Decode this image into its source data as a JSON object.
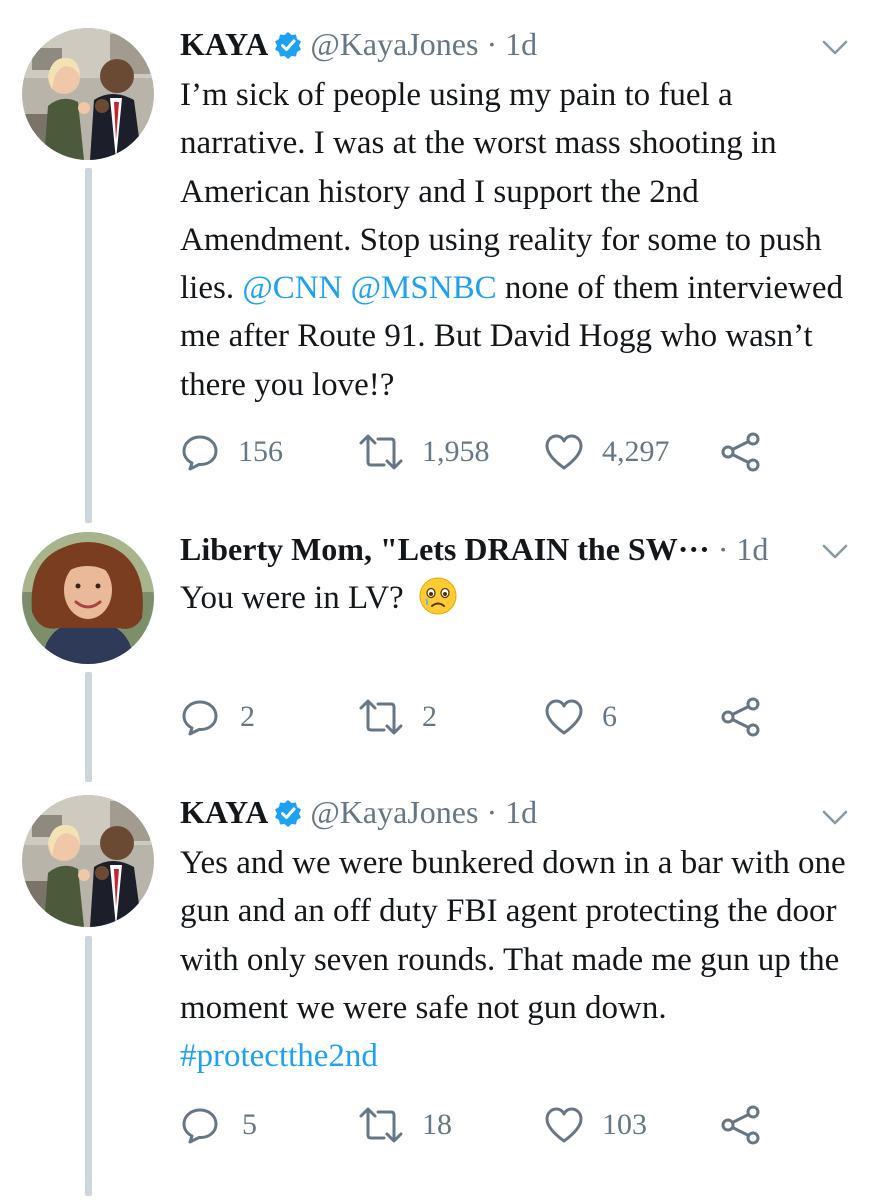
{
  "thread": [
    {
      "author": {
        "name": "KAYA",
        "verified": true,
        "handle": "@KayaJones",
        "separator": "·",
        "time": "1d",
        "avatar": "avatar-two-people-photo"
      },
      "text_parts": [
        "I’m sick of people using my pain to fuel a narrative. I was at the worst mass shooting in American history and I support the 2nd Amendment. Stop using reality for some to push lies. ",
        "@CNN",
        " ",
        "@MSNBC",
        " none of them interviewed me after Route 91. But David Hogg who wasn’t there you love!?"
      ],
      "actions": {
        "replies": "156",
        "retweets": "1,958",
        "likes": "4,297"
      }
    },
    {
      "author": {
        "name": "Liberty Mom, \"Lets DRAIN the SW···",
        "verified": false,
        "handle": "",
        "separator": "·",
        "time": "1d",
        "avatar": "avatar-woman-portrait"
      },
      "text_parts": [
        "You were in LV?"
      ],
      "emoji": "crying-face-emoji",
      "actions": {
        "replies": "2",
        "retweets": "2",
        "likes": "6"
      }
    },
    {
      "author": {
        "name": "KAYA",
        "verified": true,
        "handle": "@KayaJones",
        "separator": "·",
        "time": "1d",
        "avatar": "avatar-two-people-photo"
      },
      "text_parts": [
        "Yes and we were bunkered down in a bar with one gun and an off duty FBI agent protecting the door with only seven rounds. That made me gun up the moment we were safe not gun down. ",
        "#protectthe2nd"
      ],
      "actions": {
        "replies": "5",
        "retweets": "18",
        "likes": "103"
      }
    }
  ],
  "colors": {
    "link": "#1da1f2",
    "muted": "#657786",
    "thread_line": "#ccd6dd",
    "text": "#14171a"
  },
  "icons": [
    "reply-icon",
    "retweet-icon",
    "like-icon",
    "share-icon",
    "caret-down-icon",
    "verified-badge-icon"
  ]
}
